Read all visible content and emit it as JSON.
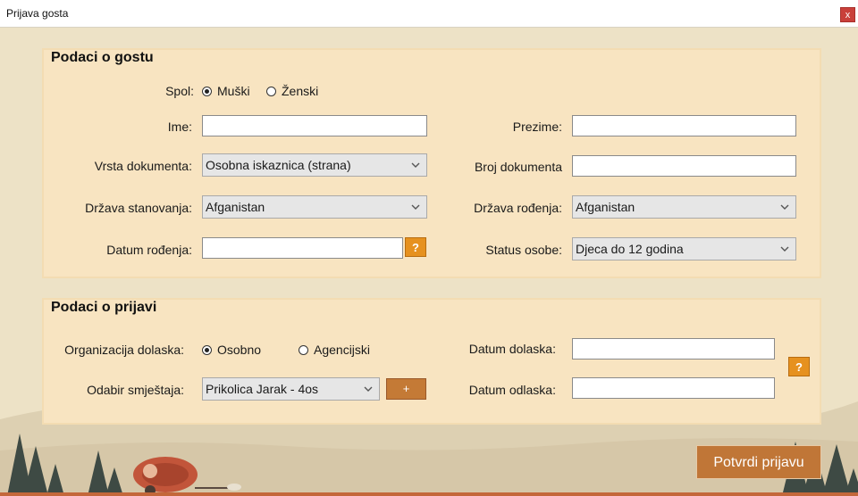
{
  "window": {
    "title": "Prijava gosta",
    "close_label": "x"
  },
  "guest": {
    "section_title": "Podaci o gostu",
    "spol_label": "Spol:",
    "spol_options": [
      "Muški",
      "Ženski"
    ],
    "spol_selected": "Muški",
    "ime_label": "Ime:",
    "ime_value": "",
    "prezime_label": "Prezime:",
    "prezime_value": "",
    "vrsta_dokumenta_label": "Vrsta dokumenta:",
    "vrsta_dokumenta_value": "Osobna iskaznica (strana)",
    "broj_dokumenta_label": "Broj dokumenta",
    "broj_dokumenta_value": "",
    "drzava_stanovanja_label": "Država stanovanja:",
    "drzava_stanovanja_value": "Afganistan",
    "drzava_rodenja_label": "Država rođenja:",
    "drzava_rodenja_value": "Afganistan",
    "datum_rodenja_label": "Datum rođenja:",
    "datum_rodenja_value": "",
    "help_label": "?",
    "status_osobe_label": "Status osobe:",
    "status_osobe_value": "Djeca do 12 godina"
  },
  "registration": {
    "section_title": "Podaci o prijavi",
    "organizacija_label": "Organizacija dolaska:",
    "organizacija_options": [
      "Osobno",
      "Agencijski"
    ],
    "organizacija_selected": "Osobno",
    "smjestaj_label": "Odabir smještaja:",
    "smjestaj_value": "Prikolica Jarak - 4os",
    "add_label": "+",
    "datum_dolaska_label": "Datum dolaska:",
    "datum_dolaska_value": "",
    "datum_odlaska_label": "Datum odlaska:",
    "datum_odlaska_value": "",
    "help_label": "?"
  },
  "submit_label": "Potvrdi prijavu",
  "colors": {
    "panel": "#f8e4c1",
    "accent_orange": "#e6911f",
    "submit_brown": "#c07637",
    "close_red": "#c9403a"
  },
  "icons": [
    "close-icon",
    "chevron-down-icon",
    "question-icon",
    "plus-icon",
    "trailer-illustration",
    "tree-illustration"
  ]
}
